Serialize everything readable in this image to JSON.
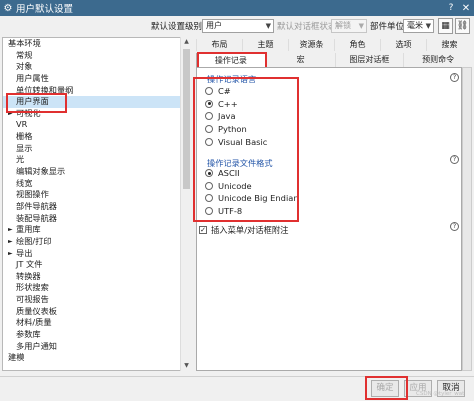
{
  "titlebar": {
    "title": "用户默认设置",
    "help": "?",
    "close": "✕"
  },
  "toolbar": {
    "level_label": "默认设置级别",
    "level_value": "用户",
    "state_label": "默认对话框状态",
    "state_value": "解锁",
    "unit_label": "部件单位",
    "unit_value": "毫米",
    "icon1": "▦",
    "icon2": "⛓"
  },
  "tree": {
    "items": [
      {
        "label": "基本环境",
        "level": 0
      },
      {
        "label": "常规",
        "level": 1
      },
      {
        "label": "对象",
        "level": 1
      },
      {
        "label": "用户属性",
        "level": 1
      },
      {
        "label": "单位转换和量纲",
        "level": 1
      },
      {
        "label": "用户界面",
        "level": 1,
        "selected": true
      },
      {
        "label": "可视化",
        "level": 0,
        "expander": "►"
      },
      {
        "label": "VR",
        "level": 1
      },
      {
        "label": "栅格",
        "level": 1
      },
      {
        "label": "显示",
        "level": 1
      },
      {
        "label": "光",
        "level": 1
      },
      {
        "label": "编辑对象显示",
        "level": 1
      },
      {
        "label": "线宽",
        "level": 1
      },
      {
        "label": "视图操作",
        "level": 1
      },
      {
        "label": "部件导航器",
        "level": 1
      },
      {
        "label": "装配导航器",
        "level": 1
      },
      {
        "label": "重用库",
        "level": 0,
        "expander": "►"
      },
      {
        "label": "绘图/打印",
        "level": 0,
        "expander": "►"
      },
      {
        "label": "导出",
        "level": 0,
        "expander": "►"
      },
      {
        "label": "JT 文件",
        "level": 1
      },
      {
        "label": "转换器",
        "level": 1
      },
      {
        "label": "形状搜索",
        "level": 1
      },
      {
        "label": "可视报告",
        "level": 1
      },
      {
        "label": "质量仪表板",
        "level": 1
      },
      {
        "label": "材料/质量",
        "level": 1
      },
      {
        "label": "参数库",
        "level": 1
      },
      {
        "label": "多用户通知",
        "level": 1
      },
      {
        "label": "建模",
        "level": 0
      }
    ]
  },
  "tabs_row1": [
    "布局",
    "主题",
    "资源条",
    "角色",
    "选项",
    "搜索"
  ],
  "tabs_row2": [
    "操作记录",
    "宏",
    "图层对话框",
    "预则命令"
  ],
  "groups": {
    "language_title": "操作记录语言",
    "language_options": [
      {
        "label": "C#",
        "checked": false
      },
      {
        "label": "C++",
        "checked": true
      },
      {
        "label": "Java",
        "checked": false
      },
      {
        "label": "Python",
        "checked": false
      },
      {
        "label": "Visual Basic",
        "checked": false
      }
    ],
    "format_title": "操作记录文件格式",
    "format_options": [
      {
        "label": "ASCII",
        "checked": true
      },
      {
        "label": "Unicode",
        "checked": false
      },
      {
        "label": "Unicode Big Endian",
        "checked": false
      },
      {
        "label": "UTF-8",
        "checked": false
      }
    ],
    "insert_checkbox": {
      "label": "插入菜单/对话框附注",
      "checked": true
    }
  },
  "buttons": {
    "ok": "确定",
    "apply": "应用",
    "cancel": "取消"
  },
  "watermark": "CSDN @tyler_wat",
  "colors": {
    "titlebar": "#3c6a8e",
    "annotation": "#e03030",
    "group_title": "#2456a8",
    "selection": "#cce4f7"
  }
}
